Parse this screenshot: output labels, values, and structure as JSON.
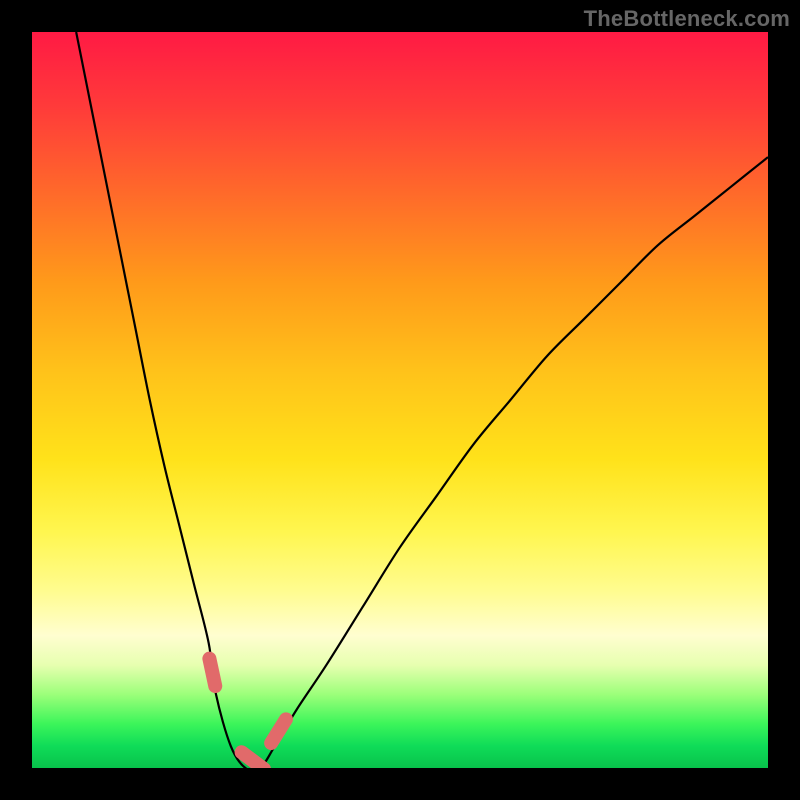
{
  "watermark": "TheBottleneck.com",
  "chart_data": {
    "type": "line",
    "title": "",
    "xlabel": "",
    "ylabel": "",
    "xlim": [
      0,
      100
    ],
    "ylim": [
      0,
      100
    ],
    "grid": false,
    "legend": false,
    "series": [
      {
        "name": "curve",
        "x": [
          6,
          8,
          10,
          12,
          14,
          16,
          18,
          20,
          22,
          24,
          25,
          27,
          29,
          31,
          33,
          36,
          40,
          45,
          50,
          55,
          60,
          65,
          70,
          75,
          80,
          85,
          90,
          95,
          100
        ],
        "values": [
          100,
          90,
          80,
          70,
          60,
          50,
          41,
          33,
          25,
          17,
          10,
          3,
          0,
          0,
          3,
          8,
          14,
          22,
          30,
          37,
          44,
          50,
          56,
          61,
          66,
          71,
          75,
          79,
          83
        ]
      }
    ],
    "markers": [
      {
        "name": "left-descent-marker",
        "x": 24.5,
        "y": 13
      },
      {
        "name": "trough-marker",
        "x": 30,
        "y": 1
      },
      {
        "name": "right-ascent-marker",
        "x": 33.5,
        "y": 5
      }
    ],
    "colors": {
      "curve": "#000000",
      "marker": "#E16A6A",
      "gradient_top": "#ff1a44",
      "gradient_bottom": "#08c24b"
    }
  }
}
